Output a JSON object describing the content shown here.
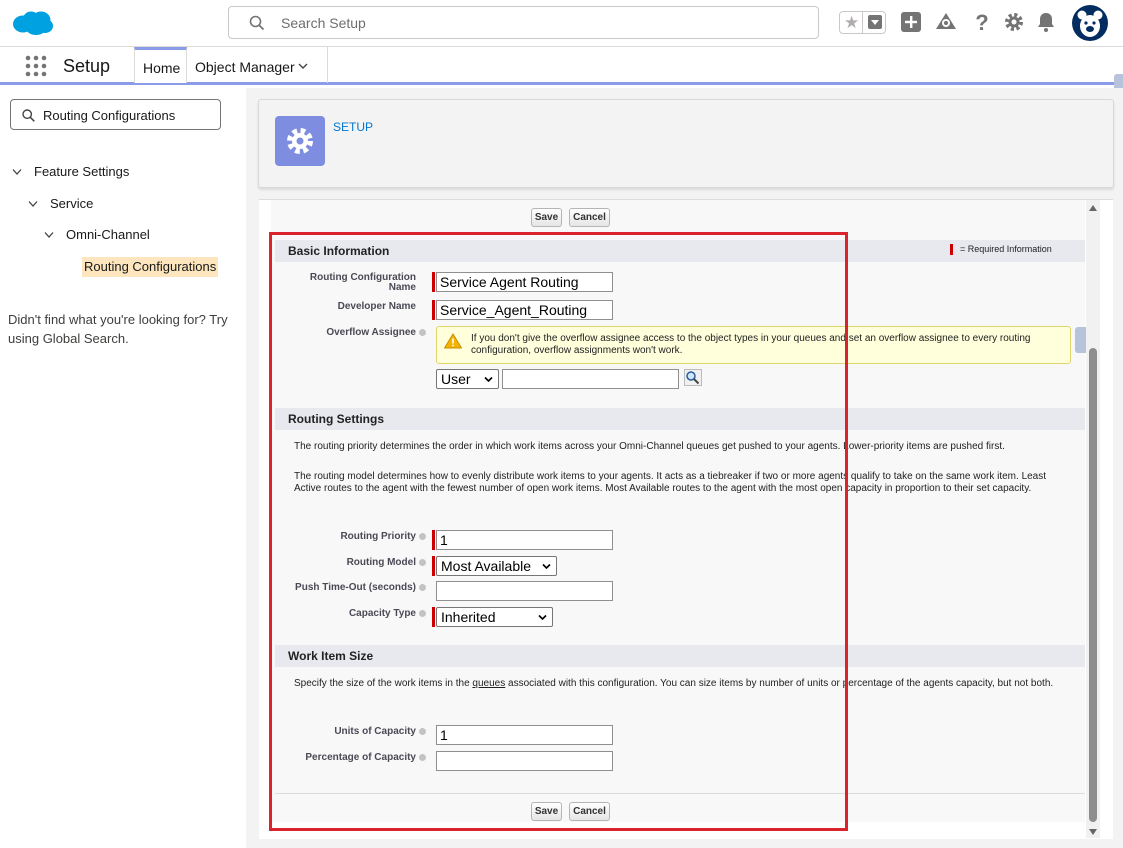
{
  "header": {
    "search_placeholder": "Search Setup"
  },
  "nav": {
    "app_title": "Setup",
    "tabs": [
      {
        "label": "Home"
      },
      {
        "label": "Object Manager"
      }
    ]
  },
  "sidebar": {
    "quick_find_value": "Routing Configurations",
    "tree": [
      {
        "label": "Feature Settings"
      },
      {
        "label": "Service"
      },
      {
        "label": "Omni-Channel"
      },
      {
        "label": "Routing Configurations"
      }
    ],
    "help_text": "Didn't find what you're looking for? Try using Global Search."
  },
  "page_header": {
    "label": "SETUP"
  },
  "form": {
    "save_label": "Save",
    "cancel_label": "Cancel",
    "required_info": "= Required Information",
    "basic_info": {
      "title": "Basic Information",
      "routing_config_name_label": "Routing Configuration Name",
      "routing_config_name_value": "Service Agent Routing",
      "developer_name_label": "Developer Name",
      "developer_name_value": "Service_Agent_Routing",
      "overflow_assignee_label": "Overflow Assignee",
      "warning": "If you don't give the overflow assignee access to the object types in your queues and set an overflow assignee to every routing configuration, overflow assignments won't work.",
      "assignee_type": "User",
      "assignee_value": ""
    },
    "routing_settings": {
      "title": "Routing Settings",
      "para1": "The routing priority determines the order in which work items across your Omni-Channel queues get pushed to your agents. Lower-priority items are pushed first.",
      "para2": "The routing model determines how to evenly distribute work items to your agents. It acts as a tiebreaker if two or more agents qualify to take on the same work item. Least Active routes to the agent with the fewest number of open work items. Most Available routes to the agent with the most open capacity in proportion to their set capacity.",
      "priority_label": "Routing Priority",
      "priority_value": "1",
      "model_label": "Routing Model",
      "model_value": "Most Available",
      "timeout_label": "Push Time-Out (seconds)",
      "timeout_value": "",
      "capacity_type_label": "Capacity Type",
      "capacity_type_value": "Inherited"
    },
    "work_item_size": {
      "title": "Work Item Size",
      "para_before": "Specify the size of the work items in the ",
      "para_link": "queues",
      "para_after": " associated with this configuration. You can size items by number of units or percentage of the agents capacity, but not both.",
      "units_label": "Units of Capacity",
      "units_value": "1",
      "percentage_label": "Percentage of Capacity",
      "percentage_value": ""
    }
  },
  "colors": {
    "brand": "#0176d3",
    "nav_accent": "#8a9ce8",
    "highlight": "#d9242e"
  }
}
